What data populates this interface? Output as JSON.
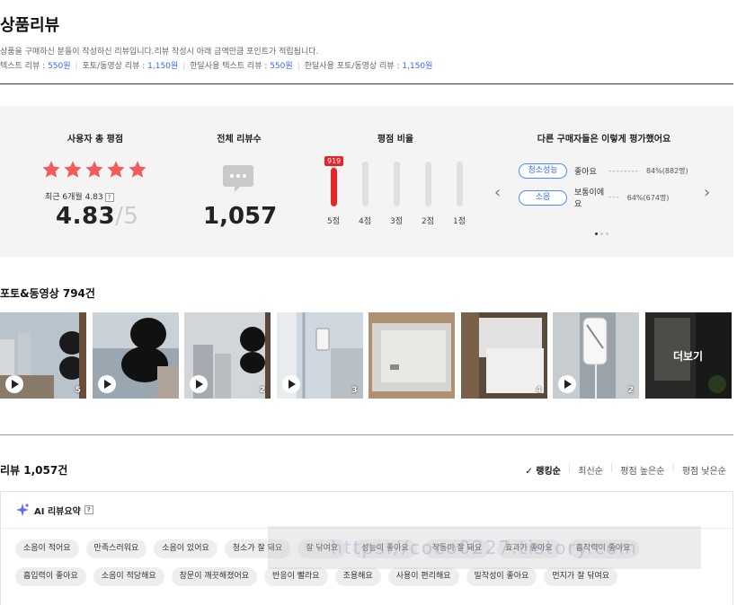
{
  "page": {
    "title": "상품리뷰",
    "intro": "상품을 구매하신 분들이 작성하신 리뷰입니다.리뷰 작성시 아래 금액만큼 포인트가 적립됩니다.",
    "points": [
      {
        "label": "텍스트 리뷰 : ",
        "amount": "550원"
      },
      {
        "label": "포토/동영상 리뷰 : ",
        "amount": "1,150원"
      },
      {
        "label": "한달사용 텍스트 리뷰 : ",
        "amount": "550원"
      },
      {
        "label": "한달사용 포토/동영상 리뷰 : ",
        "amount": "1,150원"
      }
    ]
  },
  "summary": {
    "avg_title": "사용자 총 평점",
    "star_rating": 5,
    "recent_label": "최근 6개월 4.83",
    "help_mark": "?",
    "score": "4.83",
    "score_max": "5",
    "total_title": "전체 리뷰수",
    "total_count": "1,057",
    "ratio_title": "평점 비율",
    "top_badge": "919",
    "ratio_bars": [
      {
        "label": "5점",
        "fill": 0.87
      },
      {
        "label": "4점",
        "fill": 0.0
      },
      {
        "label": "3점",
        "fill": 0.0
      },
      {
        "label": "2점",
        "fill": 0.0
      },
      {
        "label": "1점",
        "fill": 0.0
      }
    ],
    "opinion_title": "다른 구매자들은 이렇게 평가했어요",
    "opinions": [
      {
        "tag": "청소성능",
        "answer": "좋아요",
        "dash": "--------",
        "pct": "84%(882명)"
      },
      {
        "tag": "소음",
        "answer": "보통이에요",
        "dash": "---",
        "pct": "64%(674명)"
      }
    ],
    "prev_icon": "‹",
    "next_icon": "›",
    "page_dots": 3,
    "active_dot": 0
  },
  "photos": {
    "title": "포토&동영상 794건",
    "items": [
      {
        "count": "5",
        "video": true
      },
      {
        "count": "",
        "video": true
      },
      {
        "count": "2",
        "video": true
      },
      {
        "count": "3",
        "video": true
      },
      {
        "count": "",
        "video": false
      },
      {
        "count": "4",
        "video": false
      },
      {
        "count": "2",
        "video": true
      },
      {
        "count": "",
        "video": false
      }
    ],
    "more_label": "더보기"
  },
  "reviews": {
    "count_label": "리뷰 1,057건",
    "sort_options": [
      "랭킹순",
      "최신순",
      "평점 높은순",
      "평점 낮은순"
    ],
    "active_sort": 0,
    "check_icon": "✓"
  },
  "ai_summary": {
    "title": "AI 리뷰요약",
    "help_mark": "?",
    "keywords": [
      "소음이 적어요",
      "만족스러워요",
      "소음이 있어요",
      "청소가 잘 돼요",
      "잘 닦여요",
      "성능이 좋아요",
      "작동이 잘 돼요",
      "효과가 좋아요",
      "흡착력이 좋아요",
      "흡입력이 좋아요",
      "소음이 적당해요",
      "창문이 깨끗해졌어요",
      "반응이 빨라요",
      "조용해요",
      "사용이 편리해요",
      "밀착성이 좋아요",
      "먼지가 잘 닦여요"
    ]
  },
  "colors": {
    "star": "#f25c5c",
    "accent_blue": "#346aff",
    "bar_red": "#e52528",
    "panel_bg": "#f4f4f5"
  },
  "watermark": "https://coco0227.tistory.com"
}
